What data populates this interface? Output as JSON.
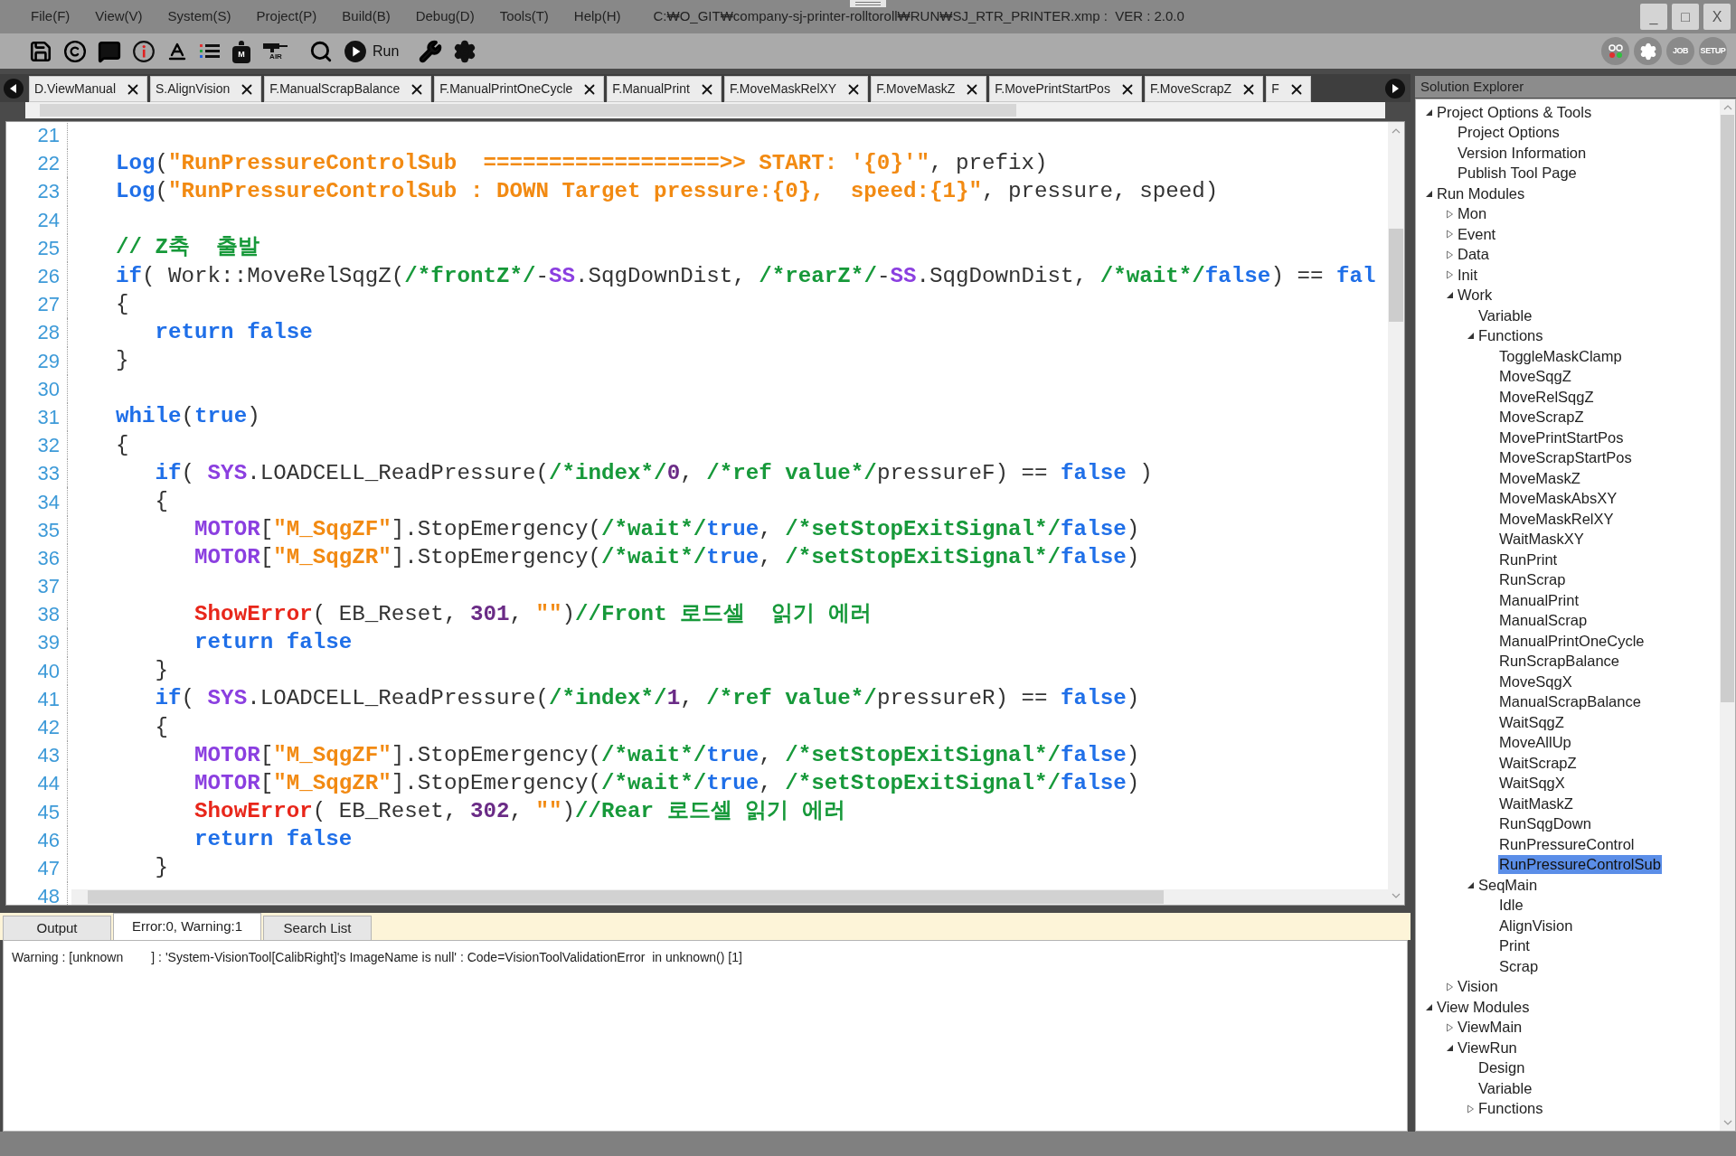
{
  "menu": [
    "File(F)",
    "View(V)",
    "System(S)",
    "Project(P)",
    "Build(B)",
    "Debug(D)",
    "Tools(T)",
    "Help(H)"
  ],
  "window": {
    "title": "C:₩O_GIT₩company-sj-printer-rolltoroll₩RUN₩SJ_RTR_PRINTER.xmp :  VER : 2.0.0",
    "controls": [
      "_",
      "□",
      "X"
    ]
  },
  "toolbar": [
    {
      "kind": "save"
    },
    {
      "kind": "copyright"
    },
    {
      "kind": "comment"
    },
    {
      "kind": "info"
    },
    {
      "kind": "font-color"
    },
    {
      "kind": "list"
    },
    {
      "kind": "motor",
      "label": "M"
    },
    {
      "kind": "air",
      "label": "AIR"
    },
    {
      "kind": "search"
    },
    {
      "kind": "run",
      "label": "Run"
    },
    {
      "kind": "wrench"
    },
    {
      "kind": "settings"
    }
  ],
  "toolbar_right": [
    {
      "kind": "lights"
    },
    {
      "kind": "settings"
    },
    {
      "kind": "text",
      "label": "JOB"
    },
    {
      "kind": "text",
      "label": "SETUP"
    }
  ],
  "tabs": [
    "D.ViewManual",
    "S.AlignVision",
    "F.ManualScrapBalance",
    "F.ManualPrintOneCycle",
    "F.ManualPrint",
    "F.MoveMaskRelXY",
    "F.MoveMaskZ",
    "F.MovePrintStartPos",
    "F.MoveScrapZ",
    "F"
  ],
  "editor": {
    "lines": [
      {
        "number": "21"
      },
      {
        "number": "22",
        "segments": [
          {
            "kind": "kw",
            "text": "Log"
          },
          {
            "kind": "txt",
            "text": "("
          },
          {
            "kind": "str",
            "text": "\"RunPressureControlSub  ==================>> START: '{0}'\""
          },
          {
            "kind": "txt",
            "text": ", prefix)"
          }
        ]
      },
      {
        "number": "23",
        "segments": [
          {
            "kind": "kw",
            "text": "Log"
          },
          {
            "kind": "txt",
            "text": "("
          },
          {
            "kind": "str",
            "text": "\"RunPressureControlSub : DOWN Target pressure:{0},  speed:{1}\""
          },
          {
            "kind": "txt",
            "text": ", pressure, speed)"
          }
        ]
      },
      {
        "number": "24"
      },
      {
        "number": "25",
        "segments": [
          {
            "kind": "cmt",
            "text": "// Z축  출발"
          }
        ]
      },
      {
        "number": "26",
        "segments": [
          {
            "kind": "kw",
            "text": "if"
          },
          {
            "kind": "txt",
            "text": "( Work::MoveRelSqgZ("
          },
          {
            "kind": "cmt",
            "text": "/*frontZ*/"
          },
          {
            "kind": "txt",
            "text": "-"
          },
          {
            "kind": "obj",
            "text": "SS"
          },
          {
            "kind": "txt",
            "text": ".SqgDownDist, "
          },
          {
            "kind": "cmt",
            "text": "/*rearZ*/"
          },
          {
            "kind": "txt",
            "text": "-"
          },
          {
            "kind": "obj",
            "text": "SS"
          },
          {
            "kind": "txt",
            "text": ".SqgDownDist, "
          },
          {
            "kind": "cmt",
            "text": "/*wait*/"
          },
          {
            "kind": "kw",
            "text": "false"
          },
          {
            "kind": "txt",
            "text": ") == "
          },
          {
            "kind": "kw",
            "text": "fal"
          }
        ]
      },
      {
        "number": "27",
        "segments": [
          {
            "kind": "txt",
            "text": "{"
          }
        ]
      },
      {
        "number": "28",
        "segments": [
          {
            "kind": "kw",
            "text": "   return false"
          }
        ]
      },
      {
        "number": "29",
        "segments": [
          {
            "kind": "txt",
            "text": "}"
          }
        ]
      },
      {
        "number": "30"
      },
      {
        "number": "31",
        "segments": [
          {
            "kind": "kw",
            "text": "while"
          },
          {
            "kind": "txt",
            "text": "("
          },
          {
            "kind": "kw",
            "text": "true"
          },
          {
            "kind": "txt",
            "text": ")"
          }
        ]
      },
      {
        "number": "32",
        "segments": [
          {
            "kind": "txt",
            "text": "{"
          }
        ]
      },
      {
        "number": "33",
        "segments": [
          {
            "kind": "kw",
            "text": "   if"
          },
          {
            "kind": "txt",
            "text": "( "
          },
          {
            "kind": "obj",
            "text": "SYS"
          },
          {
            "kind": "txt",
            "text": ".LOADCELL_ReadPressure("
          },
          {
            "kind": "cmt",
            "text": "/*index*/"
          },
          {
            "kind": "num",
            "text": "0"
          },
          {
            "kind": "txt",
            "text": ", "
          },
          {
            "kind": "cmt",
            "text": "/*ref value*/"
          },
          {
            "kind": "txt",
            "text": "pressureF) == "
          },
          {
            "kind": "kw",
            "text": "false"
          },
          {
            "kind": "txt",
            "text": " )"
          }
        ]
      },
      {
        "number": "34",
        "segments": [
          {
            "kind": "txt",
            "text": "   {"
          }
        ]
      },
      {
        "number": "35",
        "segments": [
          {
            "kind": "obj",
            "text": "      MOTOR"
          },
          {
            "kind": "txt",
            "text": "["
          },
          {
            "kind": "str",
            "text": "\"M_SqgZF\""
          },
          {
            "kind": "txt",
            "text": "].StopEmergency("
          },
          {
            "kind": "cmt",
            "text": "/*wait*/"
          },
          {
            "kind": "kw",
            "text": "true"
          },
          {
            "kind": "txt",
            "text": ", "
          },
          {
            "kind": "cmt",
            "text": "/*setStopExitSignal*/"
          },
          {
            "kind": "kw",
            "text": "false"
          },
          {
            "kind": "txt",
            "text": ")"
          }
        ]
      },
      {
        "number": "36",
        "segments": [
          {
            "kind": "obj",
            "text": "      MOTOR"
          },
          {
            "kind": "txt",
            "text": "["
          },
          {
            "kind": "str",
            "text": "\"M_SqgZR\""
          },
          {
            "kind": "txt",
            "text": "].StopEmergency("
          },
          {
            "kind": "cmt",
            "text": "/*wait*/"
          },
          {
            "kind": "kw",
            "text": "true"
          },
          {
            "kind": "txt",
            "text": ", "
          },
          {
            "kind": "cmt",
            "text": "/*setStopExitSignal*/"
          },
          {
            "kind": "kw",
            "text": "false"
          },
          {
            "kind": "txt",
            "text": ")"
          }
        ]
      },
      {
        "number": "37"
      },
      {
        "number": "38",
        "segments": [
          {
            "kind": "fn",
            "text": "      ShowError"
          },
          {
            "kind": "txt",
            "text": "( EB_Reset, "
          },
          {
            "kind": "num",
            "text": "301"
          },
          {
            "kind": "txt",
            "text": ", "
          },
          {
            "kind": "str",
            "text": "\"\""
          },
          {
            "kind": "txt",
            "text": ")"
          },
          {
            "kind": "cmt",
            "text": "//Front 로드셀  읽기 에러"
          }
        ]
      },
      {
        "number": "39",
        "segments": [
          {
            "kind": "kw",
            "text": "      return false"
          }
        ]
      },
      {
        "number": "40",
        "segments": [
          {
            "kind": "txt",
            "text": "   }"
          }
        ]
      },
      {
        "number": "41",
        "segments": [
          {
            "kind": "kw",
            "text": "   if"
          },
          {
            "kind": "txt",
            "text": "( "
          },
          {
            "kind": "obj",
            "text": "SYS"
          },
          {
            "kind": "txt",
            "text": ".LOADCELL_ReadPressure("
          },
          {
            "kind": "cmt",
            "text": "/*index*/"
          },
          {
            "kind": "num",
            "text": "1"
          },
          {
            "kind": "txt",
            "text": ", "
          },
          {
            "kind": "cmt",
            "text": "/*ref value*/"
          },
          {
            "kind": "txt",
            "text": "pressureR) == "
          },
          {
            "kind": "kw",
            "text": "false"
          },
          {
            "kind": "txt",
            "text": ")"
          }
        ]
      },
      {
        "number": "42",
        "segments": [
          {
            "kind": "txt",
            "text": "   {"
          }
        ]
      },
      {
        "number": "43",
        "segments": [
          {
            "kind": "obj",
            "text": "      MOTOR"
          },
          {
            "kind": "txt",
            "text": "["
          },
          {
            "kind": "str",
            "text": "\"M_SqgZF\""
          },
          {
            "kind": "txt",
            "text": "].StopEmergency("
          },
          {
            "kind": "cmt",
            "text": "/*wait*/"
          },
          {
            "kind": "kw",
            "text": "true"
          },
          {
            "kind": "txt",
            "text": ", "
          },
          {
            "kind": "cmt",
            "text": "/*setStopExitSignal*/"
          },
          {
            "kind": "kw",
            "text": "false"
          },
          {
            "kind": "txt",
            "text": ")"
          }
        ]
      },
      {
        "number": "44",
        "segments": [
          {
            "kind": "obj",
            "text": "      MOTOR"
          },
          {
            "kind": "txt",
            "text": "["
          },
          {
            "kind": "str",
            "text": "\"M_SqgZR\""
          },
          {
            "kind": "txt",
            "text": "].StopEmergency("
          },
          {
            "kind": "cmt",
            "text": "/*wait*/"
          },
          {
            "kind": "kw",
            "text": "true"
          },
          {
            "kind": "txt",
            "text": ", "
          },
          {
            "kind": "cmt",
            "text": "/*setStopExitSignal*/"
          },
          {
            "kind": "kw",
            "text": "false"
          },
          {
            "kind": "txt",
            "text": ")"
          }
        ]
      },
      {
        "number": "45",
        "segments": [
          {
            "kind": "fn",
            "text": "      ShowError"
          },
          {
            "kind": "txt",
            "text": "( EB_Reset, "
          },
          {
            "kind": "num",
            "text": "302"
          },
          {
            "kind": "txt",
            "text": ", "
          },
          {
            "kind": "str",
            "text": "\"\""
          },
          {
            "kind": "txt",
            "text": ")"
          },
          {
            "kind": "cmt",
            "text": "//Rear 로드셀 읽기 에러"
          }
        ]
      },
      {
        "number": "46",
        "segments": [
          {
            "kind": "kw",
            "text": "      return false"
          }
        ]
      },
      {
        "number": "47",
        "segments": [
          {
            "kind": "txt",
            "text": "   }"
          }
        ]
      },
      {
        "number": "48"
      }
    ]
  },
  "output": {
    "tabs": [
      {
        "label": "Output",
        "selected": false
      },
      {
        "label": "Error:0, Warning:1",
        "selected": true
      },
      {
        "label": "Search List",
        "selected": false
      }
    ],
    "messages": [
      "Warning : [unknown        ] : 'System-VisionTool[CalibRight]'s ImageName is null' : Code=VisionToolValidationError  in unknown() [1]"
    ]
  },
  "solution_explorer": {
    "title": "Solution Explorer",
    "items": [
      {
        "label": "Project Options & Tools",
        "expanded": true,
        "selected": false,
        "children": [
          {
            "label": "Project Options",
            "selected": false
          },
          {
            "label": "Version Information",
            "selected": false
          },
          {
            "label": "Publish Tool Page",
            "selected": false
          }
        ]
      },
      {
        "label": "Run Modules",
        "expanded": true,
        "selected": false,
        "children": [
          {
            "label": "Mon",
            "expanded": false,
            "selected": false
          },
          {
            "label": "Event",
            "expanded": false,
            "selected": false
          },
          {
            "label": "Data",
            "expanded": false,
            "selected": false
          },
          {
            "label": "Init",
            "expanded": false,
            "selected": false
          },
          {
            "label": "Work",
            "expanded": true,
            "selected": false,
            "children": [
              {
                "label": "Variable",
                "selected": false
              },
              {
                "label": "Functions",
                "expanded": true,
                "selected": false,
                "children": [
                  {
                    "label": "ToggleMaskClamp",
                    "selected": false
                  },
                  {
                    "label": "MoveSqgZ",
                    "selected": false
                  },
                  {
                    "label": "MoveRelSqgZ",
                    "selected": false
                  },
                  {
                    "label": "MoveScrapZ",
                    "selected": false
                  },
                  {
                    "label": "MovePrintStartPos",
                    "selected": false
                  },
                  {
                    "label": "MoveScrapStartPos",
                    "selected": false
                  },
                  {
                    "label": "MoveMaskZ",
                    "selected": false
                  },
                  {
                    "label": "MoveMaskAbsXY",
                    "selected": false
                  },
                  {
                    "label": "MoveMaskRelXY",
                    "selected": false
                  },
                  {
                    "label": "WaitMaskXY",
                    "selected": false
                  },
                  {
                    "label": "RunPrint",
                    "selected": false
                  },
                  {
                    "label": "RunScrap",
                    "selected": false
                  },
                  {
                    "label": "ManualPrint",
                    "selected": false
                  },
                  {
                    "label": "ManualScrap",
                    "selected": false
                  },
                  {
                    "label": "ManualPrintOneCycle",
                    "selected": false
                  },
                  {
                    "label": "RunScrapBalance",
                    "selected": false
                  },
                  {
                    "label": "MoveSqgX",
                    "selected": false
                  },
                  {
                    "label": "ManualScrapBalance",
                    "selected": false
                  },
                  {
                    "label": "WaitSqgZ",
                    "selected": false
                  },
                  {
                    "label": "MoveAllUp",
                    "selected": false
                  },
                  {
                    "label": "WaitScrapZ",
                    "selected": false
                  },
                  {
                    "label": "WaitSqgX",
                    "selected": false
                  },
                  {
                    "label": "WaitMaskZ",
                    "selected": false
                  },
                  {
                    "label": "RunSqgDown",
                    "selected": false
                  },
                  {
                    "label": "RunPressureControl",
                    "selected": false
                  },
                  {
                    "label": "RunPressureControlSub",
                    "selected": true
                  }
                ]
              },
              {
                "label": "SeqMain",
                "expanded": true,
                "selected": false,
                "children": [
                  {
                    "label": "Idle",
                    "selected": false
                  },
                  {
                    "label": "AlignVision",
                    "selected": false
                  },
                  {
                    "label": "Print",
                    "selected": false
                  },
                  {
                    "label": "Scrap",
                    "selected": false
                  }
                ]
              }
            ]
          },
          {
            "label": "Vision",
            "expanded": false,
            "selected": false
          }
        ]
      },
      {
        "label": "View Modules",
        "expanded": true,
        "selected": false,
        "children": [
          {
            "label": "ViewMain",
            "expanded": false,
            "selected": false
          },
          {
            "label": "ViewRun",
            "expanded": true,
            "selected": false,
            "children": [
              {
                "label": "Design",
                "selected": false
              },
              {
                "label": "Variable",
                "selected": false
              },
              {
                "label": "Functions",
                "expanded": false,
                "selected": false
              }
            ]
          }
        ]
      }
    ]
  }
}
